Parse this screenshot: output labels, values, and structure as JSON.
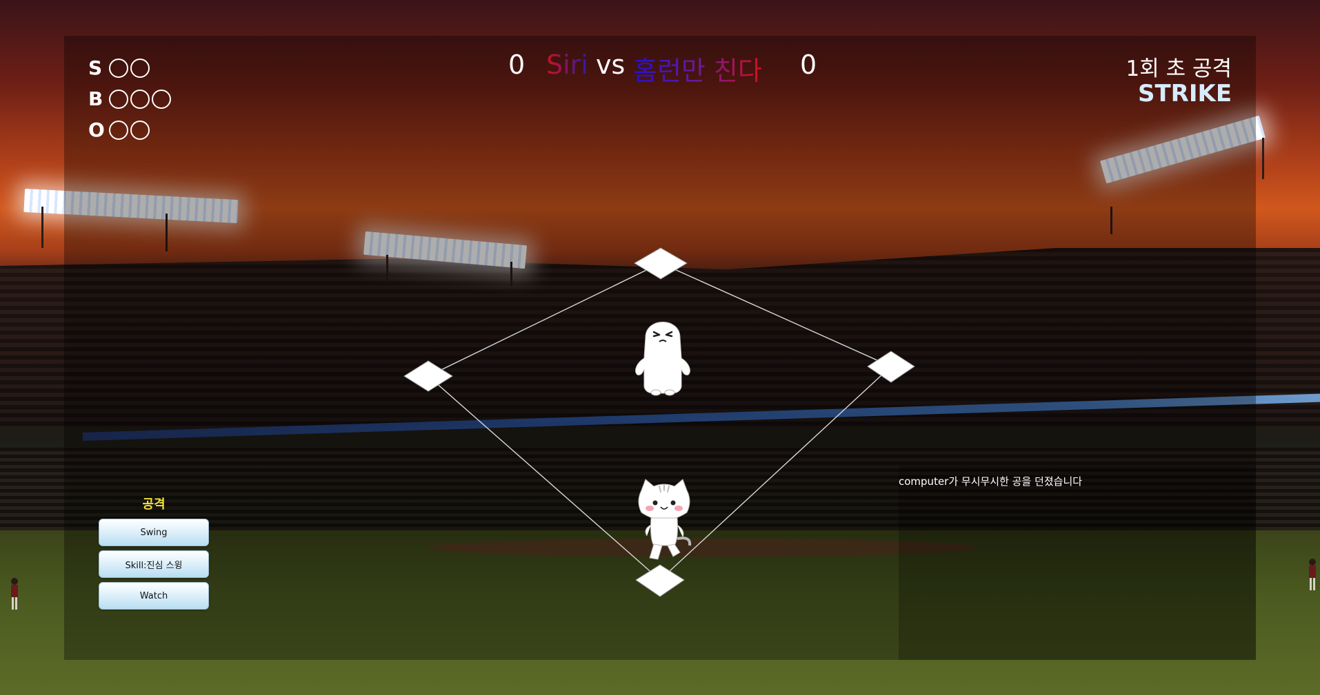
{
  "count": {
    "strike": {
      "label": "S",
      "total": 2,
      "filled": 0
    },
    "ball": {
      "label": "B",
      "total": 3,
      "filled": 0
    },
    "out": {
      "label": "O",
      "total": 2,
      "filled": 0
    }
  },
  "scoreboard": {
    "away_score": "0",
    "away_team": "Siri",
    "vs": "vs",
    "home_team": "홈런만 친다",
    "home_score": "0"
  },
  "inning": {
    "label": "1회 초 공격"
  },
  "status": {
    "label": "STRIKE"
  },
  "actions": {
    "title": "공격",
    "swing": "Swing",
    "skill": "Skill:진심 스윙",
    "watch": "Watch"
  },
  "log": {
    "message": "computer가 무시무시한 공을 던졌습니다"
  },
  "colors": {
    "away_team_gradient": [
      "#d0101a",
      "#2a1bb0"
    ],
    "home_team_gradient": [
      "#2210d4",
      "#d01020"
    ],
    "action_title": "#f4e23a",
    "status": "#d6ecff"
  },
  "icons": {
    "pitcher": "ghost-pitcher-icon",
    "batter": "cat-batter-icon",
    "base": "base-diamond-icon"
  }
}
